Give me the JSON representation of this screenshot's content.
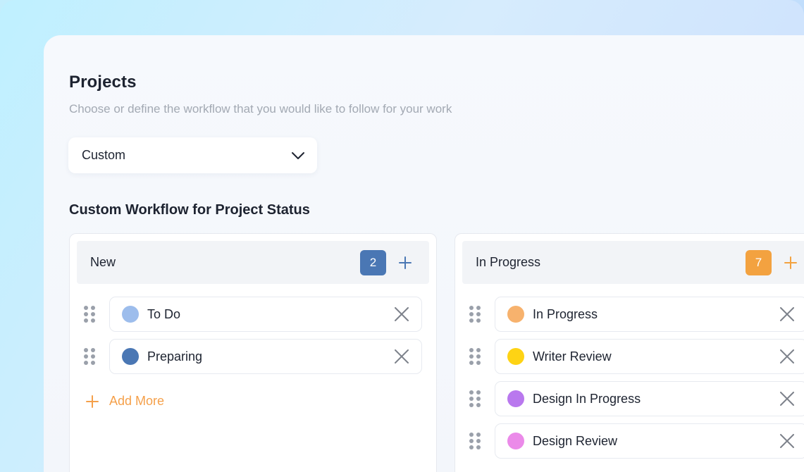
{
  "header": {
    "title": "Projects",
    "subtitle": "Choose or define the workflow that you would like to follow for your work"
  },
  "workflow_select": {
    "value": "Custom",
    "icon": "chevron-down-icon"
  },
  "section_title": "Custom Workflow for Project Status",
  "columns": [
    {
      "title": "New",
      "count": "2",
      "accent": "#4a77b4",
      "items": [
        {
          "label": "To Do",
          "color": "#9dbdec"
        },
        {
          "label": "Preparing",
          "color": "#4a77b4"
        }
      ],
      "add_more_label": "Add More"
    },
    {
      "title": "In Progress",
      "count": "7",
      "accent": "#f3a240",
      "items": [
        {
          "label": "In Progress",
          "color": "#f7b26d"
        },
        {
          "label": "Writer Review",
          "color": "#fed314"
        },
        {
          "label": "Design In Progress",
          "color": "#b978ee"
        },
        {
          "label": "Design Review",
          "color": "#eb8ae9"
        }
      ]
    }
  ],
  "colors": {
    "text_primary": "#1d2330",
    "text_muted": "#a3a9b3",
    "add_more": "#f5a04a",
    "remove_icon": "#7d828b",
    "drag_handle": "#9aa0aa"
  }
}
